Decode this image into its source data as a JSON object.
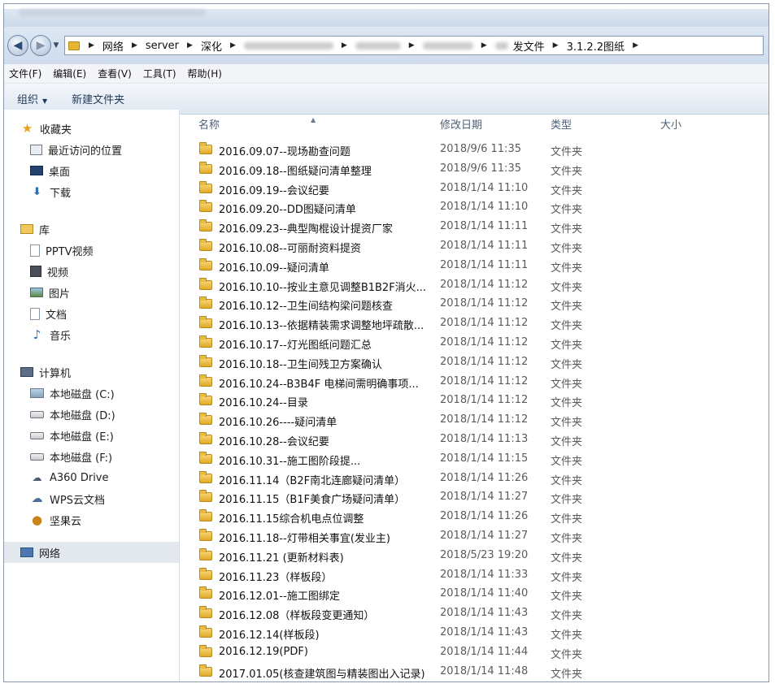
{
  "address": {
    "segments": [
      "网络",
      "server",
      "深化"
    ],
    "tail_segments": [
      "发文件",
      "3.1.2.2图纸"
    ]
  },
  "menu": [
    "文件(F)",
    "编辑(E)",
    "查看(V)",
    "工具(T)",
    "帮助(H)"
  ],
  "toolbar": {
    "organize": "组织",
    "new_folder": "新建文件夹"
  },
  "sidebar": {
    "favorites": {
      "label": "收藏夹",
      "items": [
        "最近访问的位置",
        "桌面",
        "下载"
      ]
    },
    "libraries": {
      "label": "库",
      "items": [
        "PPTV视频",
        "视频",
        "图片",
        "文档",
        "音乐"
      ]
    },
    "computer": {
      "label": "计算机",
      "items": [
        "本地磁盘 (C:)",
        "本地磁盘 (D:)",
        "本地磁盘 (E:)",
        "本地磁盘 (F:)",
        "A360 Drive",
        "WPS云文档",
        "坚果云"
      ]
    },
    "network": {
      "label": "网络"
    }
  },
  "columns": {
    "name": "名称",
    "date": "修改日期",
    "type": "类型",
    "size": "大小"
  },
  "files": [
    {
      "name": "2016.09.07--现场勘查问题",
      "date": "2018/9/6 11:35",
      "type": "文件夹"
    },
    {
      "name": "2016.09.18--图纸疑问清单整理",
      "date": "2018/9/6 11:35",
      "type": "文件夹"
    },
    {
      "name": "2016.09.19--会议纪要",
      "date": "2018/1/14 11:10",
      "type": "文件夹"
    },
    {
      "name": "2016.09.20--DD图疑问清单",
      "date": "2018/1/14 11:10",
      "type": "文件夹"
    },
    {
      "name": "2016.09.23--典型陶棍设计提资厂家",
      "date": "2018/1/14 11:11",
      "type": "文件夹"
    },
    {
      "name": "2016.10.08--可丽耐资料提资",
      "date": "2018/1/14 11:11",
      "type": "文件夹"
    },
    {
      "name": "2016.10.09--疑问清单",
      "date": "2018/1/14 11:11",
      "type": "文件夹"
    },
    {
      "name": "2016.10.10--按业主意见调整B1B2F消火...",
      "date": "2018/1/14 11:12",
      "type": "文件夹"
    },
    {
      "name": "2016.10.12--卫生间结构梁问题核查",
      "date": "2018/1/14 11:12",
      "type": "文件夹"
    },
    {
      "name": "2016.10.13--依据精装需求调整地坪疏散...",
      "date": "2018/1/14 11:12",
      "type": "文件夹"
    },
    {
      "name": "2016.10.17--灯光图纸问题汇总",
      "date": "2018/1/14 11:12",
      "type": "文件夹"
    },
    {
      "name": "2016.10.18--卫生间残卫方案确认",
      "date": "2018/1/14 11:12",
      "type": "文件夹"
    },
    {
      "name": "2016.10.24--B3B4F 电梯间需明确事项...",
      "date": "2018/1/14 11:12",
      "type": "文件夹"
    },
    {
      "name": "2016.10.24--目录",
      "date": "2018/1/14 11:12",
      "type": "文件夹"
    },
    {
      "name": "2016.10.26----疑问清单",
      "date": "2018/1/14 11:12",
      "type": "文件夹"
    },
    {
      "name": "2016.10.28--会议纪要",
      "date": "2018/1/14 11:13",
      "type": "文件夹"
    },
    {
      "name": "2016.10.31--施工图阶段提...",
      "date": "2018/1/14 11:15",
      "type": "文件夹"
    },
    {
      "name": "2016.11.14（B2F南北连廊疑问清单）",
      "date": "2018/1/14 11:26",
      "type": "文件夹"
    },
    {
      "name": "2016.11.15（B1F美食广场疑问清单）",
      "date": "2018/1/14 11:27",
      "type": "文件夹"
    },
    {
      "name": "2016.11.15综合机电点位调整",
      "date": "2018/1/14 11:26",
      "type": "文件夹"
    },
    {
      "name": "2016.11.18--灯带相关事宜(发业主)",
      "date": "2018/1/14 11:27",
      "type": "文件夹"
    },
    {
      "name": "2016.11.21 (更新材料表)",
      "date": "2018/5/23 19:20",
      "type": "文件夹"
    },
    {
      "name": "2016.11.23（样板段）",
      "date": "2018/1/14 11:33",
      "type": "文件夹"
    },
    {
      "name": "2016.12.01--施工图绑定",
      "date": "2018/1/14 11:40",
      "type": "文件夹"
    },
    {
      "name": "2016.12.08（样板段变更通知）",
      "date": "2018/1/14 11:43",
      "type": "文件夹"
    },
    {
      "name": "2016.12.14(样板段)",
      "date": "2018/1/14 11:43",
      "type": "文件夹"
    },
    {
      "name": "2016.12.19(PDF)",
      "date": "2018/1/14 11:44",
      "type": "文件夹"
    },
    {
      "name": "2017.01.05(核查建筑图与精装图出入记录)",
      "date": "2018/1/14 11:48",
      "type": "文件夹"
    }
  ]
}
